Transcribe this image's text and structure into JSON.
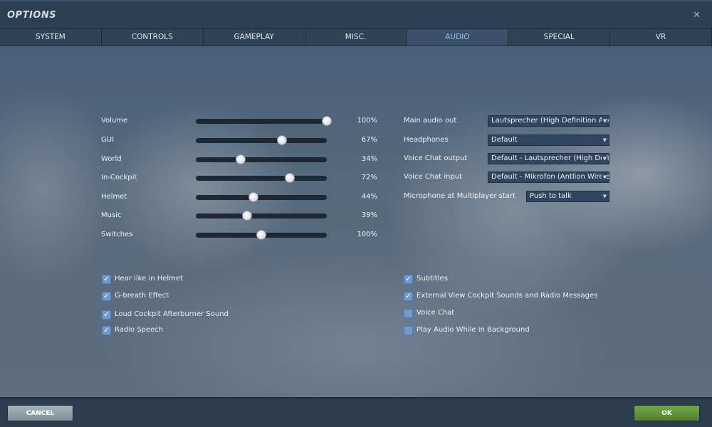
{
  "window": {
    "title": "OPTIONS",
    "close_icon": "close-icon"
  },
  "tabs": [
    {
      "label": "SYSTEM"
    },
    {
      "label": "CONTROLS"
    },
    {
      "label": "GAMEPLAY"
    },
    {
      "label": "MISC."
    },
    {
      "label": "AUDIO",
      "active": true
    },
    {
      "label": "SPECIAL"
    },
    {
      "label": "VR"
    }
  ],
  "sliders": [
    {
      "label": "Volume",
      "value": "100%",
      "position": 1.0
    },
    {
      "label": "GUI",
      "value": "67%",
      "position": 0.66
    },
    {
      "label": "World",
      "value": "34%",
      "position": 0.34
    },
    {
      "label": "In-Cockpit",
      "value": "72%",
      "position": 0.72
    },
    {
      "label": "Helmet",
      "value": "44%",
      "position": 0.44
    },
    {
      "label": "Music",
      "value": "39%",
      "position": 0.39
    },
    {
      "label": "Switches",
      "value": "100%",
      "position": 0.5
    }
  ],
  "dropdowns": [
    {
      "label": "Main audio out",
      "value": "Lautsprecher (High Definition Audi"
    },
    {
      "label": "Headphones",
      "value": "Default"
    },
    {
      "label": "Voice Chat output",
      "value": "Default - Lautsprecher (High Defin"
    },
    {
      "label": "Voice Chat input",
      "value": "Default - Mikrofon (Antlion Wireles"
    },
    {
      "label": "Microphone at Multiplayer start",
      "value": "Push to talk"
    }
  ],
  "checkboxes_left": [
    {
      "label": "Hear like in Helmet",
      "checked": true
    },
    {
      "label": "G-breath Effect",
      "checked": true
    },
    {
      "label": "Loud Cockpit Afterburner Sound",
      "checked": true
    },
    {
      "label": "Radio Speech",
      "checked": true
    }
  ],
  "checkboxes_right": [
    {
      "label": "Subtitles",
      "checked": true
    },
    {
      "label": "External View Cockpit Sounds and Radio Messages",
      "checked": true
    },
    {
      "label": "Voice Chat",
      "checked": false
    },
    {
      "label": "Play Audio While in Background",
      "checked": false
    }
  ],
  "footer": {
    "cancel_label": "CANCEL",
    "ok_label": "OK"
  },
  "colors": {
    "accent": "#8fc3e8",
    "ok": "#5f9238",
    "checkbox": "#6f9bd0"
  }
}
